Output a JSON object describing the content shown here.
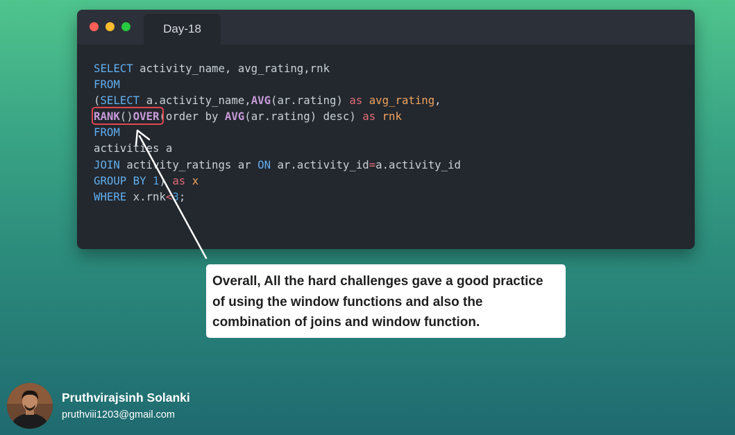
{
  "window": {
    "tab_label": "Day-18",
    "controls": [
      "close",
      "minimize",
      "maximize"
    ]
  },
  "code_lines": [
    [
      {
        "t": "SELECT",
        "c": "kw"
      },
      {
        "t": " activity_name, avg_rating,rnk",
        "c": "plain"
      }
    ],
    [
      {
        "t": "FROM",
        "c": "kw"
      }
    ],
    [
      {
        "t": "(",
        "c": "plain"
      },
      {
        "t": "SELECT",
        "c": "kw"
      },
      {
        "t": " a.activity_name,",
        "c": "plain"
      },
      {
        "t": "AVG",
        "c": "fn"
      },
      {
        "t": "(ar.rating) ",
        "c": "plain"
      },
      {
        "t": "as",
        "c": "as"
      },
      {
        "t": " ",
        "c": "plain"
      },
      {
        "t": "avg_rating",
        "c": "alias"
      },
      {
        "t": ",",
        "c": "plain"
      }
    ],
    [
      {
        "t": "RANK",
        "c": "fn"
      },
      {
        "t": "()",
        "c": "plain"
      },
      {
        "t": "OVER",
        "c": "fn"
      },
      {
        "t": "(order by ",
        "c": "plain"
      },
      {
        "t": "AVG",
        "c": "fn"
      },
      {
        "t": "(ar.rating) desc) ",
        "c": "plain"
      },
      {
        "t": "as",
        "c": "as"
      },
      {
        "t": " ",
        "c": "plain"
      },
      {
        "t": "rnk",
        "c": "alias"
      }
    ],
    [
      {
        "t": "FROM",
        "c": "kw"
      }
    ],
    [
      {
        "t": "activities a",
        "c": "plain"
      }
    ],
    [
      {
        "t": "JOIN",
        "c": "kw"
      },
      {
        "t": " activity_ratings ar ",
        "c": "plain"
      },
      {
        "t": "ON",
        "c": "kw"
      },
      {
        "t": " ar.activity_id",
        "c": "plain"
      },
      {
        "t": "=",
        "c": "op"
      },
      {
        "t": "a.activity_id",
        "c": "plain"
      }
    ],
    [
      {
        "t": "GROUP BY",
        "c": "kw"
      },
      {
        "t": " ",
        "c": "plain"
      },
      {
        "t": "1",
        "c": "num"
      },
      {
        "t": ") ",
        "c": "plain"
      },
      {
        "t": "as",
        "c": "as"
      },
      {
        "t": " ",
        "c": "plain"
      },
      {
        "t": "x",
        "c": "alias"
      }
    ],
    [
      {
        "t": "WHERE",
        "c": "kw"
      },
      {
        "t": " x.rnk",
        "c": "plain"
      },
      {
        "t": "<",
        "c": "op"
      },
      {
        "t": "3",
        "c": "num"
      },
      {
        "t": ";",
        "c": "plain"
      }
    ]
  ],
  "callout": {
    "lines": [
      "Overall, All the hard challenges gave a good practice",
      "of using the window functions and also the",
      "combination of joins and window function."
    ]
  },
  "author": {
    "name": "Pruthvirajsinh Solanki",
    "email": "pruthviii1203@gmail.com"
  },
  "colors": {
    "keyword": "#61afef",
    "function": "#c79bd8",
    "as_keyword": "#e06c75",
    "alias": "#f0a45d",
    "highlight_box": "#e0474c"
  }
}
